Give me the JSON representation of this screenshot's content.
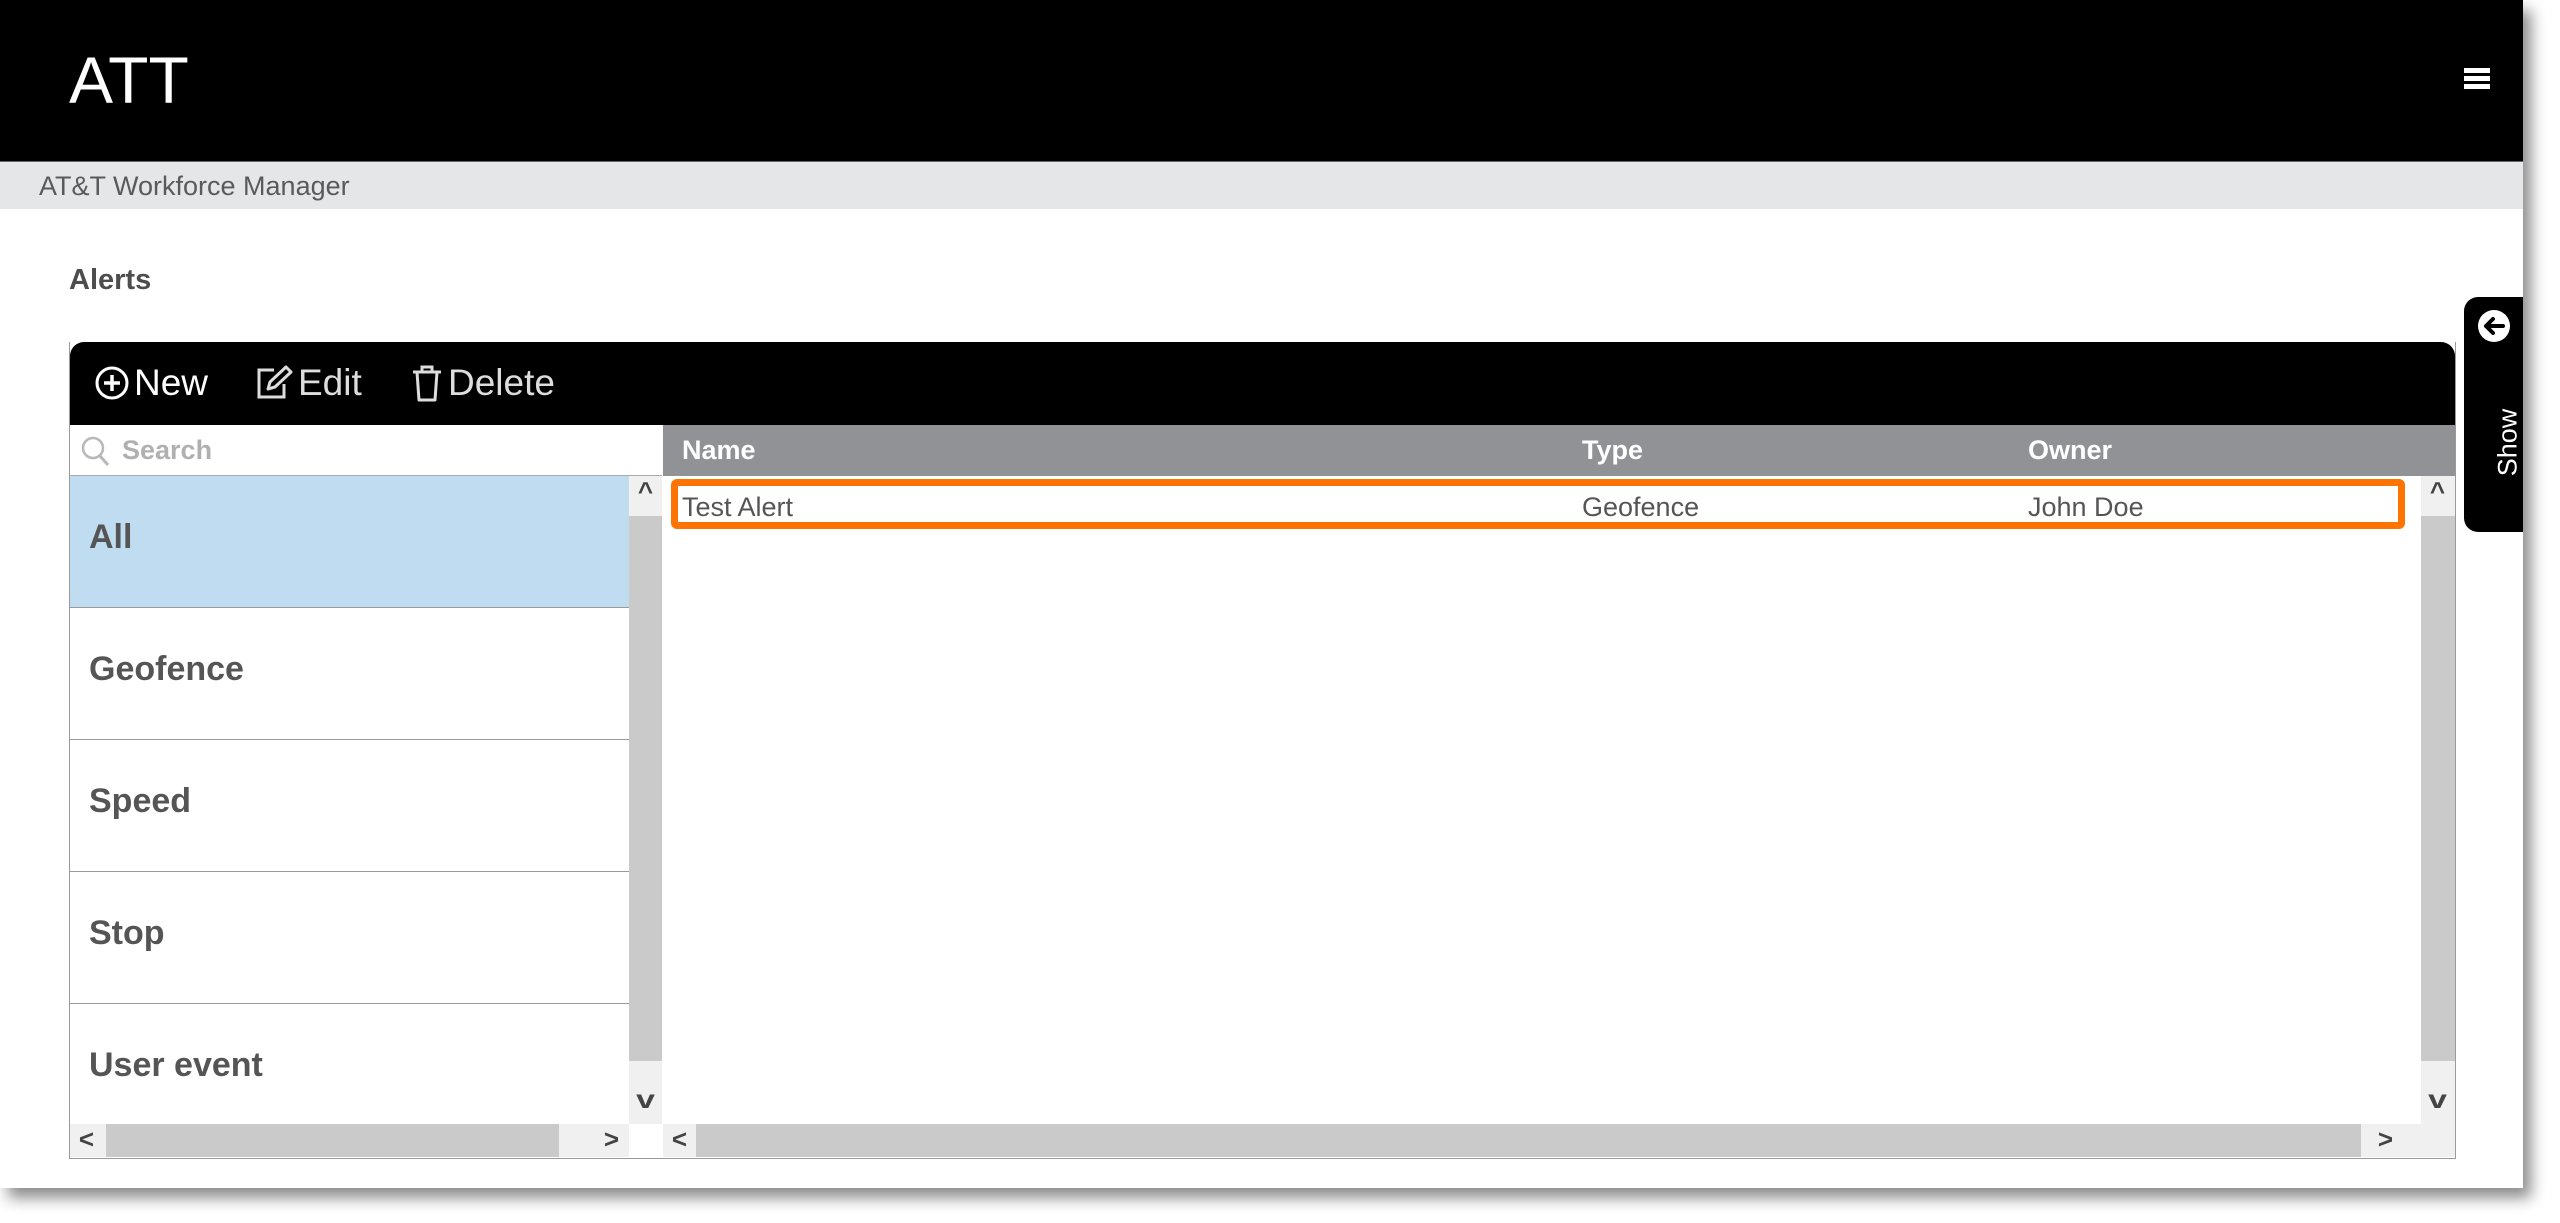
{
  "app": {
    "brand": "ATT",
    "subtitle": "AT&T Workforce Manager",
    "menu_icon": "hamburger-icon"
  },
  "page": {
    "title": "Alerts"
  },
  "toolbar": {
    "new_label": "New",
    "new_icon": "plus-circle-icon",
    "edit_label": "Edit",
    "edit_icon": "edit-icon",
    "delete_label": "Delete",
    "delete_icon": "trash-icon"
  },
  "search": {
    "placeholder": "Search",
    "value": ""
  },
  "categories": [
    {
      "label": "All",
      "selected": true
    },
    {
      "label": "Geofence",
      "selected": false
    },
    {
      "label": "Speed",
      "selected": false
    },
    {
      "label": "Stop",
      "selected": false
    },
    {
      "label": "User event",
      "selected": false
    }
  ],
  "table": {
    "columns": [
      "Name",
      "Type",
      "Owner"
    ],
    "rows": [
      {
        "name": "Test Alert",
        "type": "Geofence",
        "owner": "John Doe",
        "highlighted": true
      }
    ]
  },
  "side_panel": {
    "label": "Show",
    "icon": "arrow-left-circle-icon"
  },
  "colors": {
    "highlight": "#ff7400",
    "selected_category": "#c0dcf0",
    "table_header": "#919295"
  },
  "scroll_glyphs": {
    "up": "^",
    "down": "v",
    "left": "<",
    "right": ">"
  }
}
